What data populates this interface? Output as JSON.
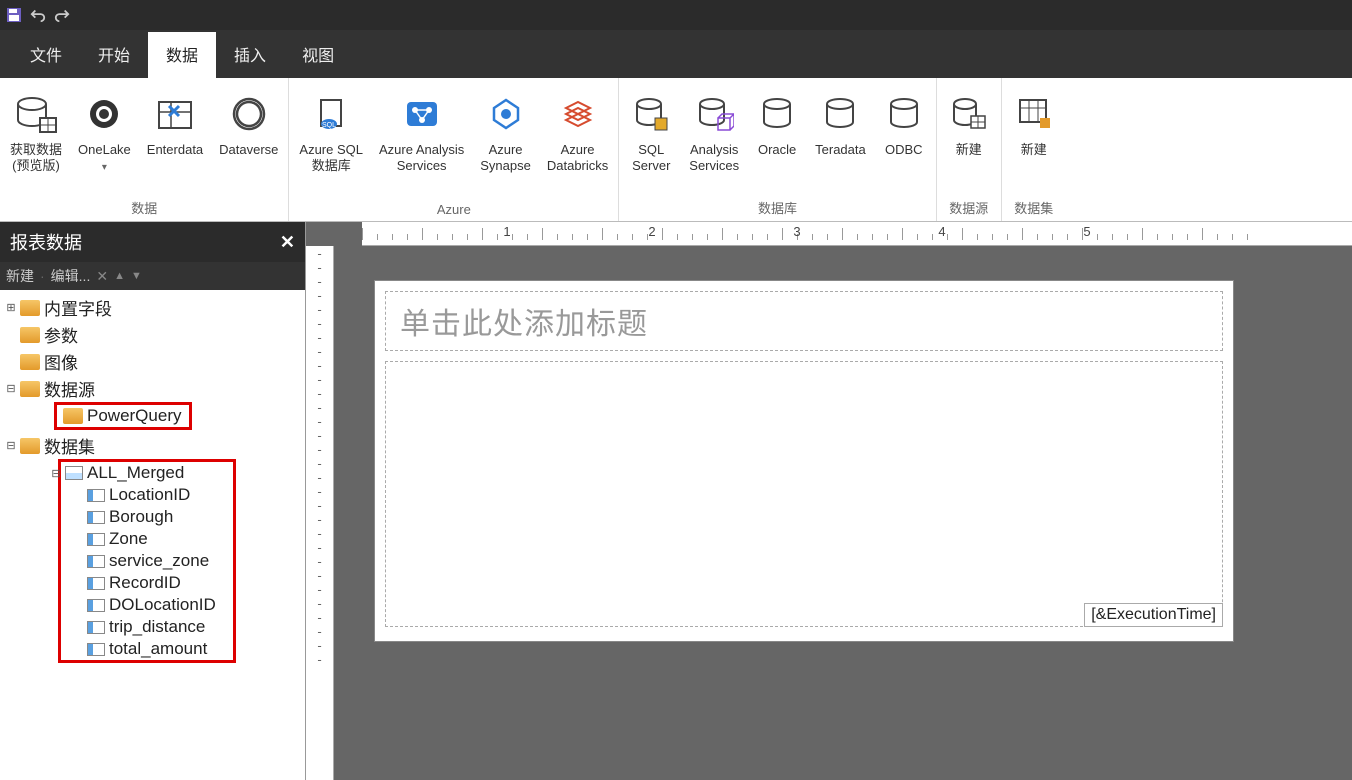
{
  "quick_access": {
    "save": "save",
    "undo": "undo",
    "redo": "redo"
  },
  "tabs": {
    "file": "文件",
    "home": "开始",
    "data": "数据",
    "insert": "插入",
    "view": "视图",
    "active": "data"
  },
  "ribbon": {
    "group_data": {
      "label": "数据",
      "buttons": {
        "get_data": "获取数据\n(预览版)",
        "onelake": "OneLake",
        "enterdata": "Enterdata",
        "dataverse": "Dataverse"
      }
    },
    "group_azure": {
      "label": "Azure",
      "buttons": {
        "azure_sql": "Azure SQL\n数据库",
        "azure_as": "Azure Analysis\nServices",
        "azure_synapse": "Azure\nSynapse",
        "azure_databricks": "Azure\nDatabricks"
      }
    },
    "group_db": {
      "label": "数据库",
      "buttons": {
        "sql_server": "SQL\nServer",
        "analysis_services": "Analysis\nServices",
        "oracle": "Oracle",
        "teradata": "Teradata",
        "odbc": "ODBC"
      }
    },
    "group_ds": {
      "label": "数据源",
      "buttons": {
        "new_ds": "新建"
      }
    },
    "group_dset": {
      "label": "数据集",
      "buttons": {
        "new_dset": "新建"
      }
    }
  },
  "sidepanel": {
    "title": "报表数据",
    "toolbar": {
      "new": "新建",
      "edit": "编辑...",
      "arrow_up": "▲",
      "arrow_down": "▼",
      "delete": "✕"
    },
    "tree": {
      "builtin": "内置字段",
      "params": "参数",
      "images": "图像",
      "datasources": "数据源",
      "datasource_item": "PowerQuery",
      "datasets": "数据集",
      "dataset_item": "ALL_Merged",
      "fields": [
        "LocationID",
        "Borough",
        "Zone",
        "service_zone",
        "RecordID",
        "DOLocationID",
        "trip_distance",
        "total_amount"
      ]
    }
  },
  "ruler": {
    "marks": [
      "1",
      "2",
      "3",
      "4",
      "5"
    ]
  },
  "canvas": {
    "title_placeholder": "单击此处添加标题",
    "execution_time": "[&ExecutionTime]"
  }
}
